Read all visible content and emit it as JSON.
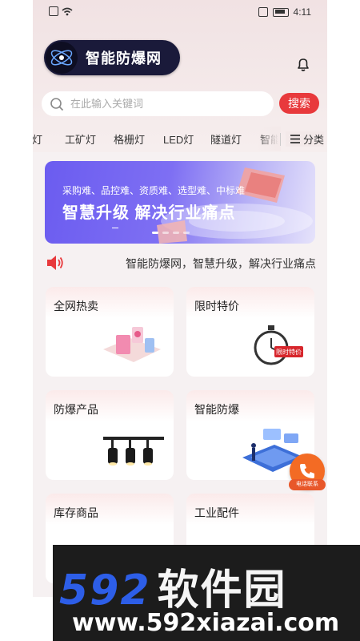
{
  "status_bar": {
    "time": "4:11"
  },
  "header": {
    "app_name": "智能防爆网"
  },
  "search": {
    "placeholder": "在此输入关键词",
    "button_label": "搜索"
  },
  "categories": {
    "items": [
      "灯",
      "工矿灯",
      "格栅灯",
      "LED灯",
      "隧道灯",
      "智能"
    ],
    "more_label": "分类"
  },
  "banner": {
    "subtitle": "采购难、品控难、资质难、选型难、中标难",
    "title": "智慧升级 解决行业痛点",
    "dot_count": 4,
    "active_dot": 1
  },
  "notice": {
    "text": "智能防爆网，智慧升级，解决行业痛点"
  },
  "cards": [
    {
      "title": "全网热卖"
    },
    {
      "title": "限时特价",
      "badge": "限时特价"
    },
    {
      "title": "防爆产品"
    },
    {
      "title": "智能防爆"
    },
    {
      "title": "库存商品"
    },
    {
      "title": "工业配件"
    }
  ],
  "contact": {
    "label": "电话联系"
  },
  "watermark": {
    "logo_num": "592",
    "logo_cn": "软件园",
    "url": "www.592xiazai.com"
  },
  "colors": {
    "accent_red": "#e8393c",
    "float_orange": "#f36b24",
    "banner_purple": "#6b5cf0"
  }
}
